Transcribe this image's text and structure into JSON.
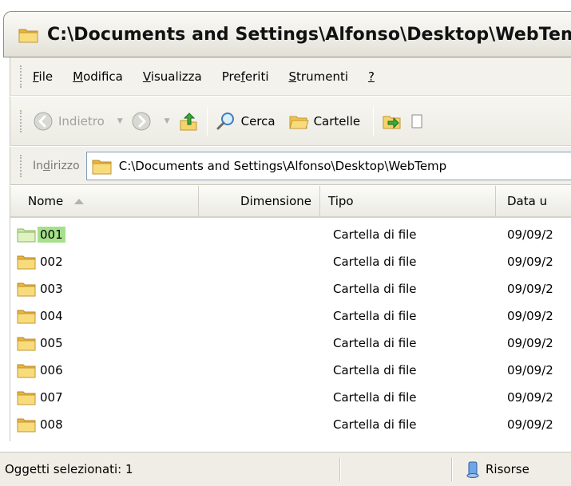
{
  "window": {
    "title": "C:\\Documents and Settings\\Alfonso\\Desktop\\WebTem"
  },
  "menu": [
    {
      "prefix": "",
      "accel": "F",
      "rest": "ile"
    },
    {
      "prefix": "",
      "accel": "M",
      "rest": "odifica"
    },
    {
      "prefix": "",
      "accel": "V",
      "rest": "isualizza"
    },
    {
      "prefix": "Pre",
      "accel": "f",
      "rest": "eriti"
    },
    {
      "prefix": "",
      "accel": "S",
      "rest": "trumenti"
    },
    {
      "prefix": "",
      "accel": "?",
      "rest": ""
    }
  ],
  "toolbar": {
    "back_label": "Indietro",
    "search_label": "Cerca",
    "folders_label": "Cartelle"
  },
  "address": {
    "label_prefix": "In",
    "label_accel": "d",
    "label_rest": "irizzo",
    "value": "C:\\Documents and Settings\\Alfonso\\Desktop\\WebTemp"
  },
  "columns": {
    "name": "Nome",
    "size": "Dimensione",
    "type": "Tipo",
    "date": "Data u"
  },
  "rows": [
    {
      "name": "001",
      "type": "Cartella di file",
      "date": "09/09/2"
    },
    {
      "name": "002",
      "type": "Cartella di file",
      "date": "09/09/2"
    },
    {
      "name": "003",
      "type": "Cartella di file",
      "date": "09/09/2"
    },
    {
      "name": "004",
      "type": "Cartella di file",
      "date": "09/09/2"
    },
    {
      "name": "005",
      "type": "Cartella di file",
      "date": "09/09/2"
    },
    {
      "name": "006",
      "type": "Cartella di file",
      "date": "09/09/2"
    },
    {
      "name": "007",
      "type": "Cartella di file",
      "date": "09/09/2"
    },
    {
      "name": "008",
      "type": "Cartella di file",
      "date": "09/09/2"
    }
  ],
  "selected_row": 0,
  "status": {
    "selection": "Oggetti selezionati: 1",
    "zone": "Risorse"
  },
  "colors": {
    "selection_highlight": "#a5e08b",
    "folder_yellow": "#f5d36b",
    "address_border": "#7f9db9"
  }
}
